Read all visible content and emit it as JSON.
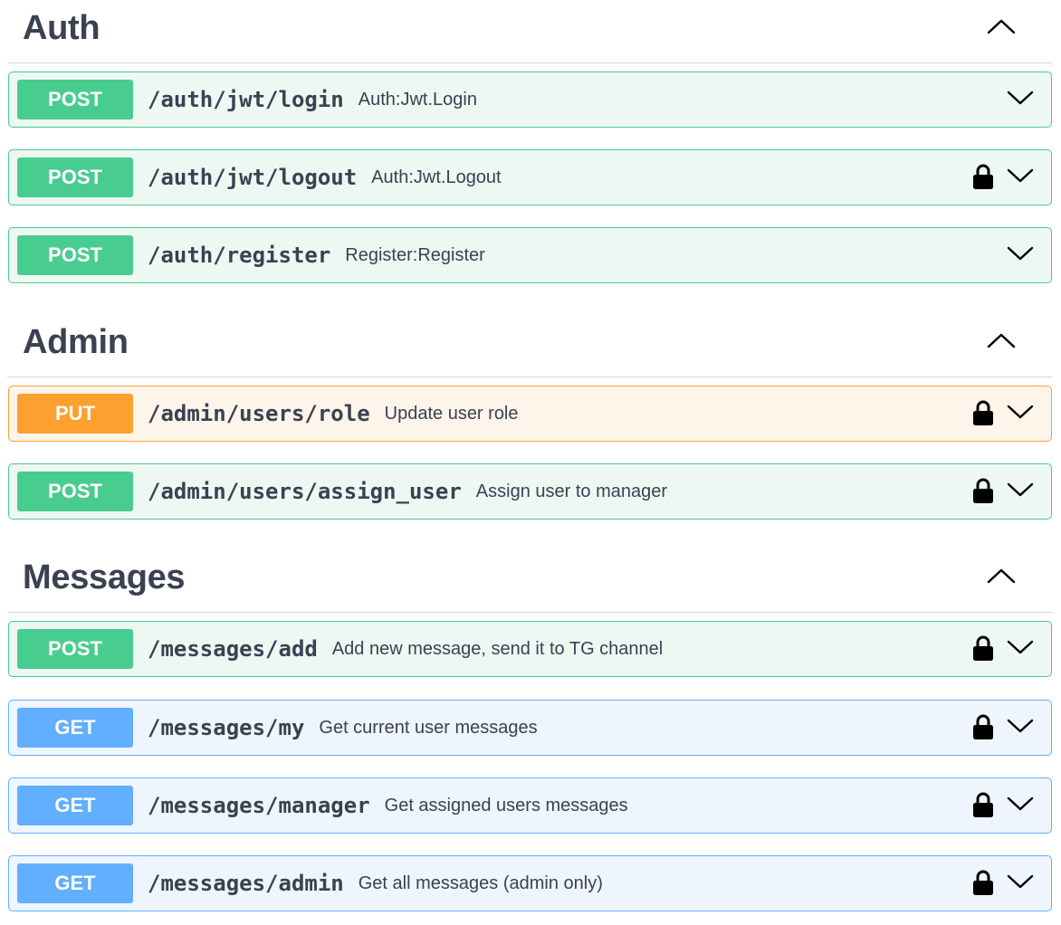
{
  "sections": [
    {
      "title": "Auth",
      "toggle_icon": "chevron-up-icon",
      "operations": [
        {
          "method": "POST",
          "path": "/auth/jwt/login",
          "summary": "Auth:Jwt.Login",
          "locked": false
        },
        {
          "method": "POST",
          "path": "/auth/jwt/logout",
          "summary": "Auth:Jwt.Logout",
          "locked": true
        },
        {
          "method": "POST",
          "path": "/auth/register",
          "summary": "Register:Register",
          "locked": false
        }
      ]
    },
    {
      "title": "Admin",
      "toggle_icon": "chevron-up-icon",
      "operations": [
        {
          "method": "PUT",
          "path": "/admin/users/role",
          "summary": "Update user role",
          "locked": true
        },
        {
          "method": "POST",
          "path": "/admin/users/assign_user",
          "summary": "Assign user to manager",
          "locked": true
        }
      ]
    },
    {
      "title": "Messages",
      "toggle_icon": "chevron-up-icon",
      "operations": [
        {
          "method": "POST",
          "path": "/messages/add",
          "summary": "Add new message, send it to TG channel",
          "locked": true
        },
        {
          "method": "GET",
          "path": "/messages/my",
          "summary": "Get current user messages",
          "locked": true
        },
        {
          "method": "GET",
          "path": "/messages/manager",
          "summary": "Get assigned users messages",
          "locked": true
        },
        {
          "method": "GET",
          "path": "/messages/admin",
          "summary": "Get all messages (admin only)",
          "locked": true
        }
      ]
    }
  ],
  "colors": {
    "post": "#49cc90",
    "put": "#fca130",
    "get": "#61affe",
    "text": "#3b4151"
  },
  "icons": {
    "lock": "lock-icon",
    "expand": "chevron-down-icon",
    "collapse": "chevron-up-icon"
  }
}
